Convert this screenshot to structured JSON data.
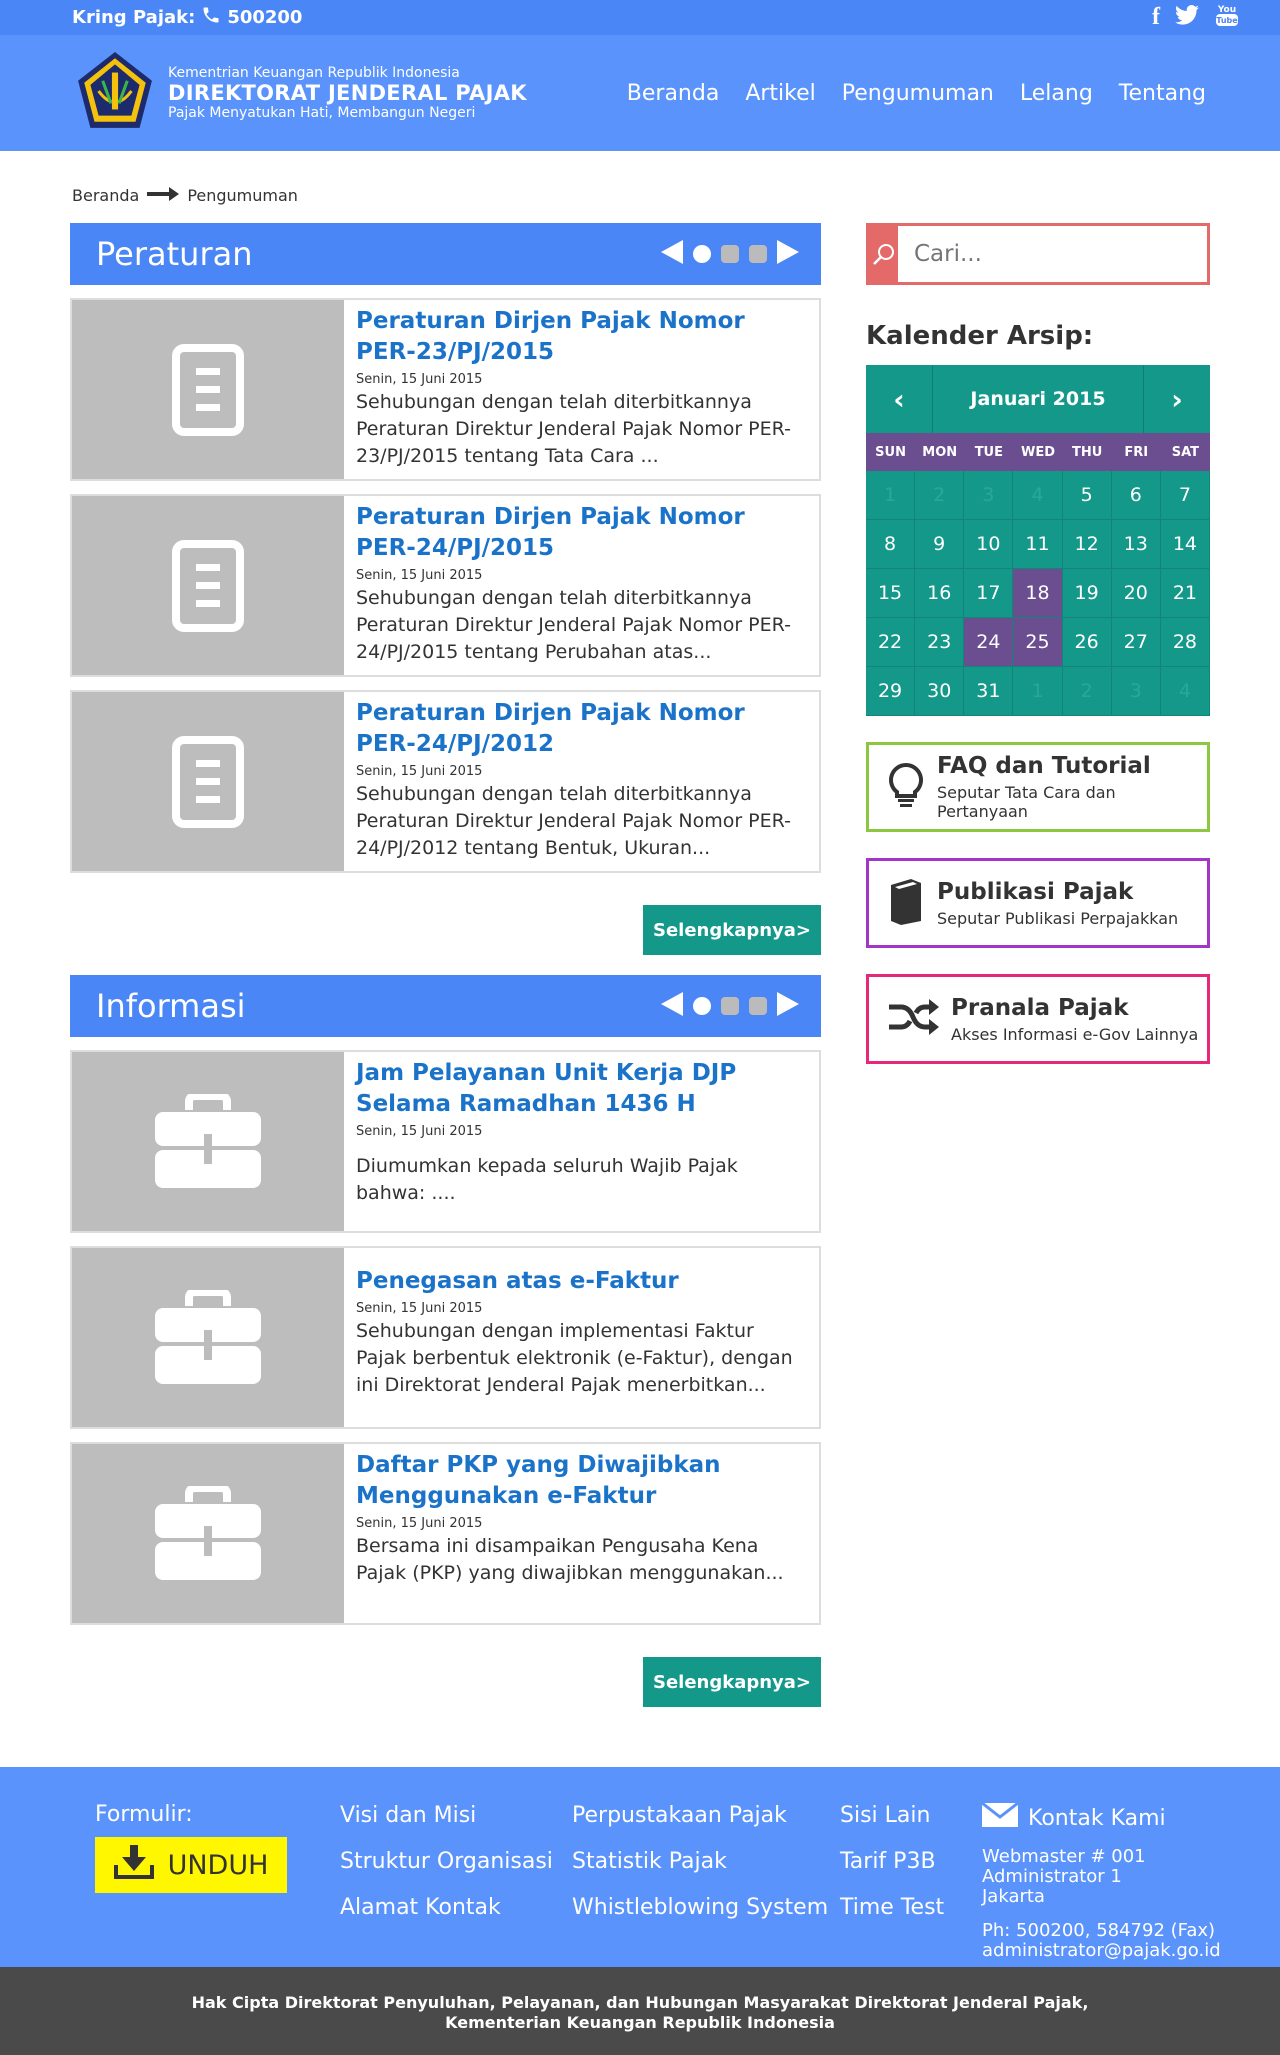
{
  "topbar": {
    "label": "Kring Pajak:",
    "number": "500200"
  },
  "brand": {
    "line1": "Kementrian Keuangan Republik Indonesia",
    "line2": "DIREKTORAT JENDERAL PAJAK",
    "line3": "Pajak Menyatukan Hati, Membangun Negeri"
  },
  "nav": [
    "Beranda",
    "Artikel",
    "Pengumuman",
    "Lelang",
    "Tentang"
  ],
  "breadcrumb": {
    "home": "Beranda",
    "current": "Pengumuman"
  },
  "peraturan": {
    "title": "Peraturan",
    "items": [
      {
        "title": "Peraturan Dirjen Pajak Nomor PER-23/PJ/2015",
        "date": "Senin, 15 Juni 2015",
        "excerpt": "Sehubungan dengan telah diterbitkannya Peraturan Direktur Jenderal Pajak Nomor PER-23/PJ/2015 tentang Tata Cara ..."
      },
      {
        "title": "Peraturan Dirjen Pajak Nomor PER-24/PJ/2015",
        "date": "Senin, 15 Juni 2015",
        "excerpt": "Sehubungan dengan telah diterbitkannya Peraturan Direktur Jenderal Pajak Nomor PER-24/PJ/2015 tentang Perubahan atas..."
      },
      {
        "title": "Peraturan Dirjen Pajak Nomor PER-24/PJ/2012",
        "date": "Senin, 15 Juni 2015",
        "excerpt": "Sehubungan dengan telah diterbitkannya Peraturan Direktur Jenderal Pajak Nomor PER-24/PJ/2012 tentang Bentuk, Ukuran..."
      }
    ],
    "more": "Selengkapnya>"
  },
  "informasi": {
    "title": "Informasi",
    "items": [
      {
        "title": "Jam Pelayanan Unit Kerja DJP Selama Ramadhan 1436 H",
        "date": "Senin, 15 Juni 2015",
        "excerpt": "Diumumkan kepada seluruh Wajib Pajak bahwa: ...."
      },
      {
        "title": "Penegasan atas e-Faktur",
        "date": "Senin, 15 Juni 2015",
        "excerpt": "Sehubungan dengan implementasi Faktur Pajak berbentuk elektronik (e-Faktur), dengan ini Direktorat Jenderal Pajak menerbitkan..."
      },
      {
        "title": "Daftar PKP yang Diwajibkan Menggunakan e-Faktur",
        "date": "Senin, 15 Juni 2015",
        "excerpt": "Bersama ini disampaikan Pengusaha Kena Pajak (PKP) yang diwajibkan menggunakan..."
      }
    ],
    "more": "Selengkapnya>"
  },
  "search": {
    "placeholder": "Cari..."
  },
  "calendar": {
    "title": "Kalender Arsip:",
    "month": "Januari 2015",
    "dow": [
      "SUN",
      "MON",
      "TUE",
      "WED",
      "THU",
      "FRI",
      "SAT"
    ],
    "days": [
      "1",
      "2",
      "3",
      "4",
      "5",
      "6",
      "7",
      "8",
      "9",
      "10",
      "11",
      "12",
      "13",
      "14",
      "15",
      "16",
      "17",
      "18",
      "19",
      "20",
      "21",
      "22",
      "23",
      "24",
      "25",
      "26",
      "27",
      "28",
      "29",
      "30",
      "31",
      "1",
      "2",
      "3",
      "4"
    ],
    "muted_indices": [
      0,
      1,
      2,
      3,
      31,
      32,
      33,
      34
    ],
    "highlight_indices": [
      17,
      23,
      24
    ]
  },
  "boxes": [
    {
      "title": "FAQ dan Tutorial",
      "sub": "Seputar Tata Cara dan Pertanyaan",
      "color": "#8dc63f",
      "icon": "lightbulb-icon"
    },
    {
      "title": "Publikasi Pajak",
      "sub": "Seputar Publikasi Perpajakkan",
      "color": "#a335c9",
      "icon": "book-icon"
    },
    {
      "title": "Pranala Pajak",
      "sub": "Akses Informasi e-Gov Lainnya",
      "color": "#e6287a",
      "icon": "shuffle-icon"
    }
  ],
  "footer": {
    "formulir": "Formulir:",
    "unduh": "UNDUH",
    "col1": [
      "Visi dan Misi",
      "Struktur Organisasi",
      "Alamat Kontak"
    ],
    "col2": [
      "Perpustakaan Pajak",
      "Statistik Pajak",
      "Whistleblowing System"
    ],
    "col3": [
      "Sisi Lain",
      "Tarif P3B",
      "Time Test"
    ],
    "contact_title": "Kontak Kami",
    "contact_lines": [
      "Webmaster # 001",
      "Administrator 1",
      "Jakarta"
    ],
    "contact_phone": "Ph: 500200, 584792 (Fax)",
    "contact_email": "administrator@pajak.go.id"
  },
  "copyright": {
    "line1": "Hak Cipta Direktorat Penyuluhan, Pelayanan, dan Hubungan Masyarakat Direktorat Jenderal Pajak,",
    "line2": "Kementerian Keuangan Republik Indonesia"
  }
}
